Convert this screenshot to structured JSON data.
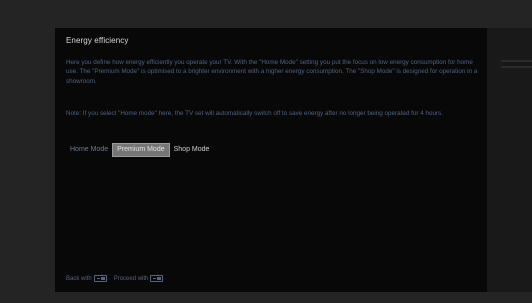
{
  "dialog": {
    "title": "Energy efficiency",
    "paragraph1": "Here you define how energy efficiently you operate your TV. With the \"Home Mode\" setting you put the focus on low energy consumption for home use. The \"Premium Mode\" is optimised to a brighter environment with a higher energy consumption. The \"Shop Mode\" is designed for operation in a showroom.",
    "paragraph2": "Note: If you select \"Home mode\" here, the TV set will automatically switch off to save energy after no longer being operated for 4 hours."
  },
  "modes": [
    {
      "label": "Home Mode",
      "state": "normal"
    },
    {
      "label": "Premium Mode",
      "state": "selected"
    },
    {
      "label": "Shop Mode",
      "state": "normal"
    }
  ],
  "footer": {
    "back_label": "Back with",
    "back_icon": "back-key-icon",
    "proceed_label": "Proceed with",
    "proceed_icon": "ok-key-icon"
  },
  "colors": {
    "panel_bg": "#080808",
    "title": "#d9d9d9",
    "body_text": "#4e6282",
    "selected_button_bg": "#767676"
  }
}
